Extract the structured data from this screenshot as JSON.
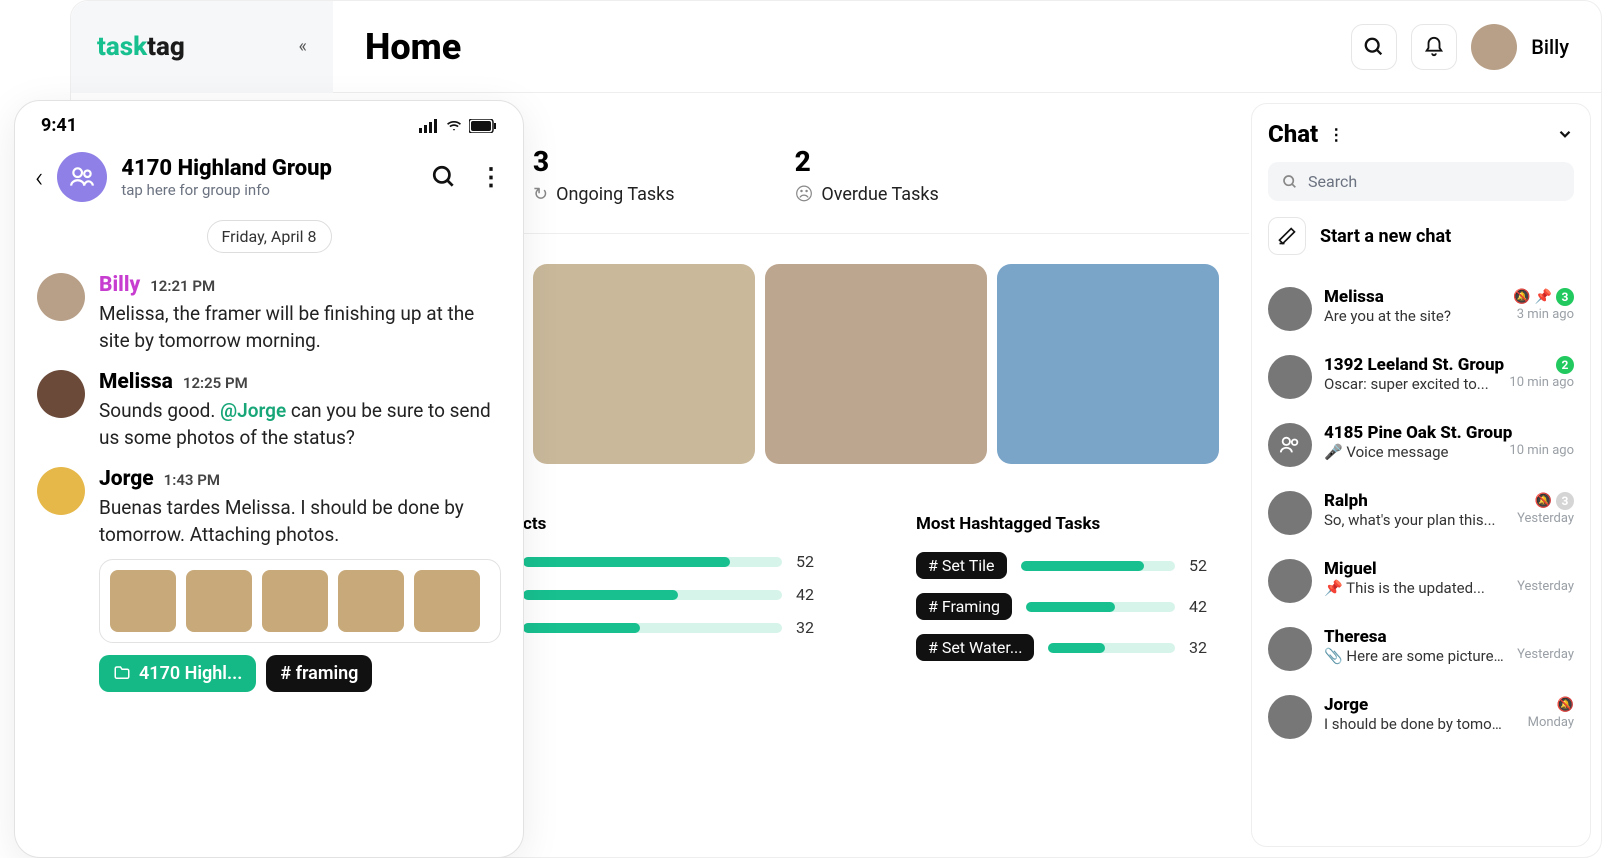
{
  "header": {
    "logo_prefix": "task",
    "logo_suffix": "tag",
    "page_title": "Home",
    "username": "Billy"
  },
  "stats": [
    {
      "value": "3",
      "label": "Ongoing Tasks",
      "icon": "refresh"
    },
    {
      "value": "2",
      "label": "Overdue Tasks",
      "icon": "sad"
    }
  ],
  "hashtags": {
    "col1": {
      "title": "cts",
      "rows": [
        {
          "val": "52",
          "fill": 80
        },
        {
          "val": "42",
          "fill": 60
        },
        {
          "val": "32",
          "fill": 45
        }
      ]
    },
    "col2": {
      "title": "Most Hashtagged Tasks",
      "rows": [
        {
          "pill": "# Set Tile",
          "val": "52",
          "fill": 80
        },
        {
          "pill": "# Framing",
          "val": "42",
          "fill": 60
        },
        {
          "pill": "# Set Water...",
          "val": "32",
          "fill": 45
        }
      ]
    }
  },
  "chart_data": {
    "type": "bar",
    "title": "Most Hashtagged Tasks",
    "categories": [
      "Set Tile",
      "Framing",
      "Set Water..."
    ],
    "values": [
      52,
      42,
      32
    ],
    "ylim": [
      0,
      60
    ]
  },
  "chat": {
    "title": "Chat",
    "search_placeholder": "Search",
    "new_chat_label": "Start a new chat",
    "items": [
      {
        "name": "Melissa",
        "preview": "Are you at the site?",
        "time": "3 min ago",
        "icons": [
          "mute",
          "pin"
        ],
        "badge": "3",
        "badge_color": "green"
      },
      {
        "name": "1392 Leeland St. Group",
        "preview": "Oscar: super excited to...",
        "time": "10 min ago",
        "badge": "2",
        "badge_color": "green",
        "group": true
      },
      {
        "name": "4185 Pine Oak St. Group",
        "preview": "Voice message",
        "time": "10 min ago",
        "prefix_icon": "mic",
        "group": true,
        "group_purple": true
      },
      {
        "name": "Ralph",
        "preview": "So, what's your plan this...",
        "time": "Yesterday",
        "icons": [
          "mute"
        ],
        "badge": "3",
        "badge_color": "grey"
      },
      {
        "name": "Miguel",
        "preview": "This is the updated...",
        "time": "Yesterday",
        "prefix_icon": "pin"
      },
      {
        "name": "Theresa",
        "preview": "Here are some pictures...",
        "time": "Yesterday",
        "prefix_icon": "clip"
      },
      {
        "name": "Jorge",
        "preview": "I should be done by tomor...",
        "time": "Monday",
        "icons": [
          "mute"
        ]
      }
    ]
  },
  "mobile": {
    "time": "9:41",
    "group_name": "4170 Highland Group",
    "group_sub": "tap here for group info",
    "date": "Friday, April 8",
    "messages": [
      {
        "name": "Billy",
        "time": "12:21 PM",
        "text": "Melissa, the framer will be finishing up at the site by tomorrow morning.",
        "color": "billy"
      },
      {
        "name": "Melissa",
        "time": "12:25 PM",
        "text_pre": "Sounds good. ",
        "mention": "@Jorge",
        "text_post": " can you be sure to send us some photos of the status?"
      },
      {
        "name": "Jorge",
        "time": "1:43 PM",
        "text": "Buenas tardes Melissa. I should be done by tomorrow. Attaching photos."
      }
    ],
    "thumbs": 5,
    "tag_project": "4170 Highl...",
    "tag_hash": "# framing"
  }
}
